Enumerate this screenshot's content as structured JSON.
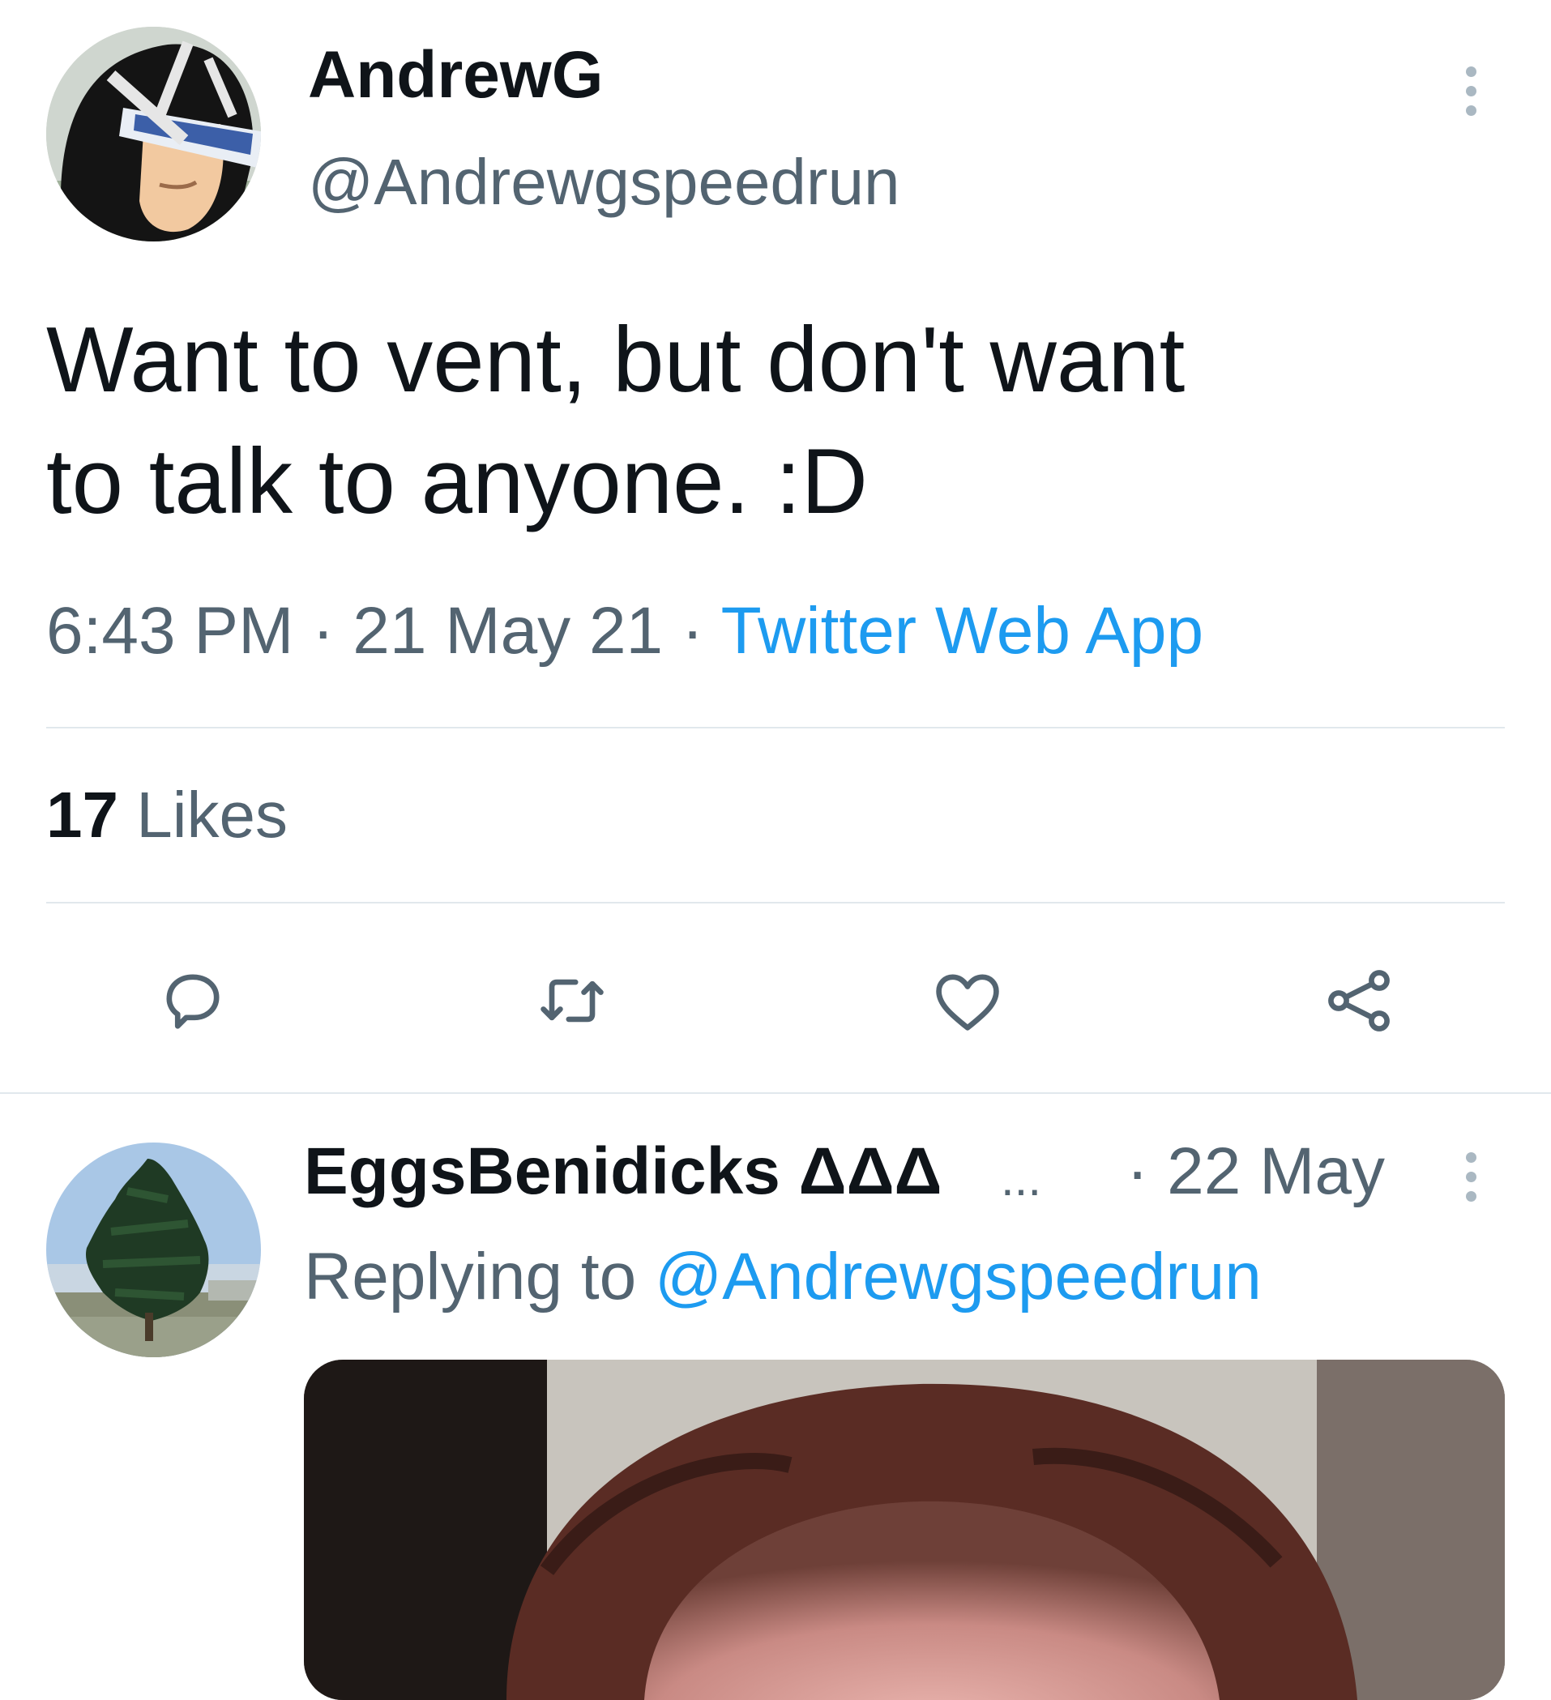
{
  "tweet": {
    "display_name": "AndrewG",
    "handle": "@Andrewgspeedrun",
    "text": "Want to vent, but don't want\nto talk to anyone. :D",
    "time": "6:43 PM",
    "date": "21 May 21",
    "source": "Twitter Web App",
    "separator": " · ",
    "likes_count": "17",
    "likes_label": "Likes"
  },
  "reply": {
    "display_name": "EggsBenidicks ΔΔΔ",
    "ellipsis": "...",
    "date": "· 22 May",
    "replying_prefix": "Replying to ",
    "replying_to": "@Andrewgspeedrun"
  },
  "actions": [
    "reply-icon",
    "retweet-icon",
    "like-icon",
    "share-icon"
  ],
  "colors": {
    "text": "#0f1419",
    "secondary": "#536471",
    "link": "#1d9bf0",
    "divider": "#e1e8ed"
  }
}
